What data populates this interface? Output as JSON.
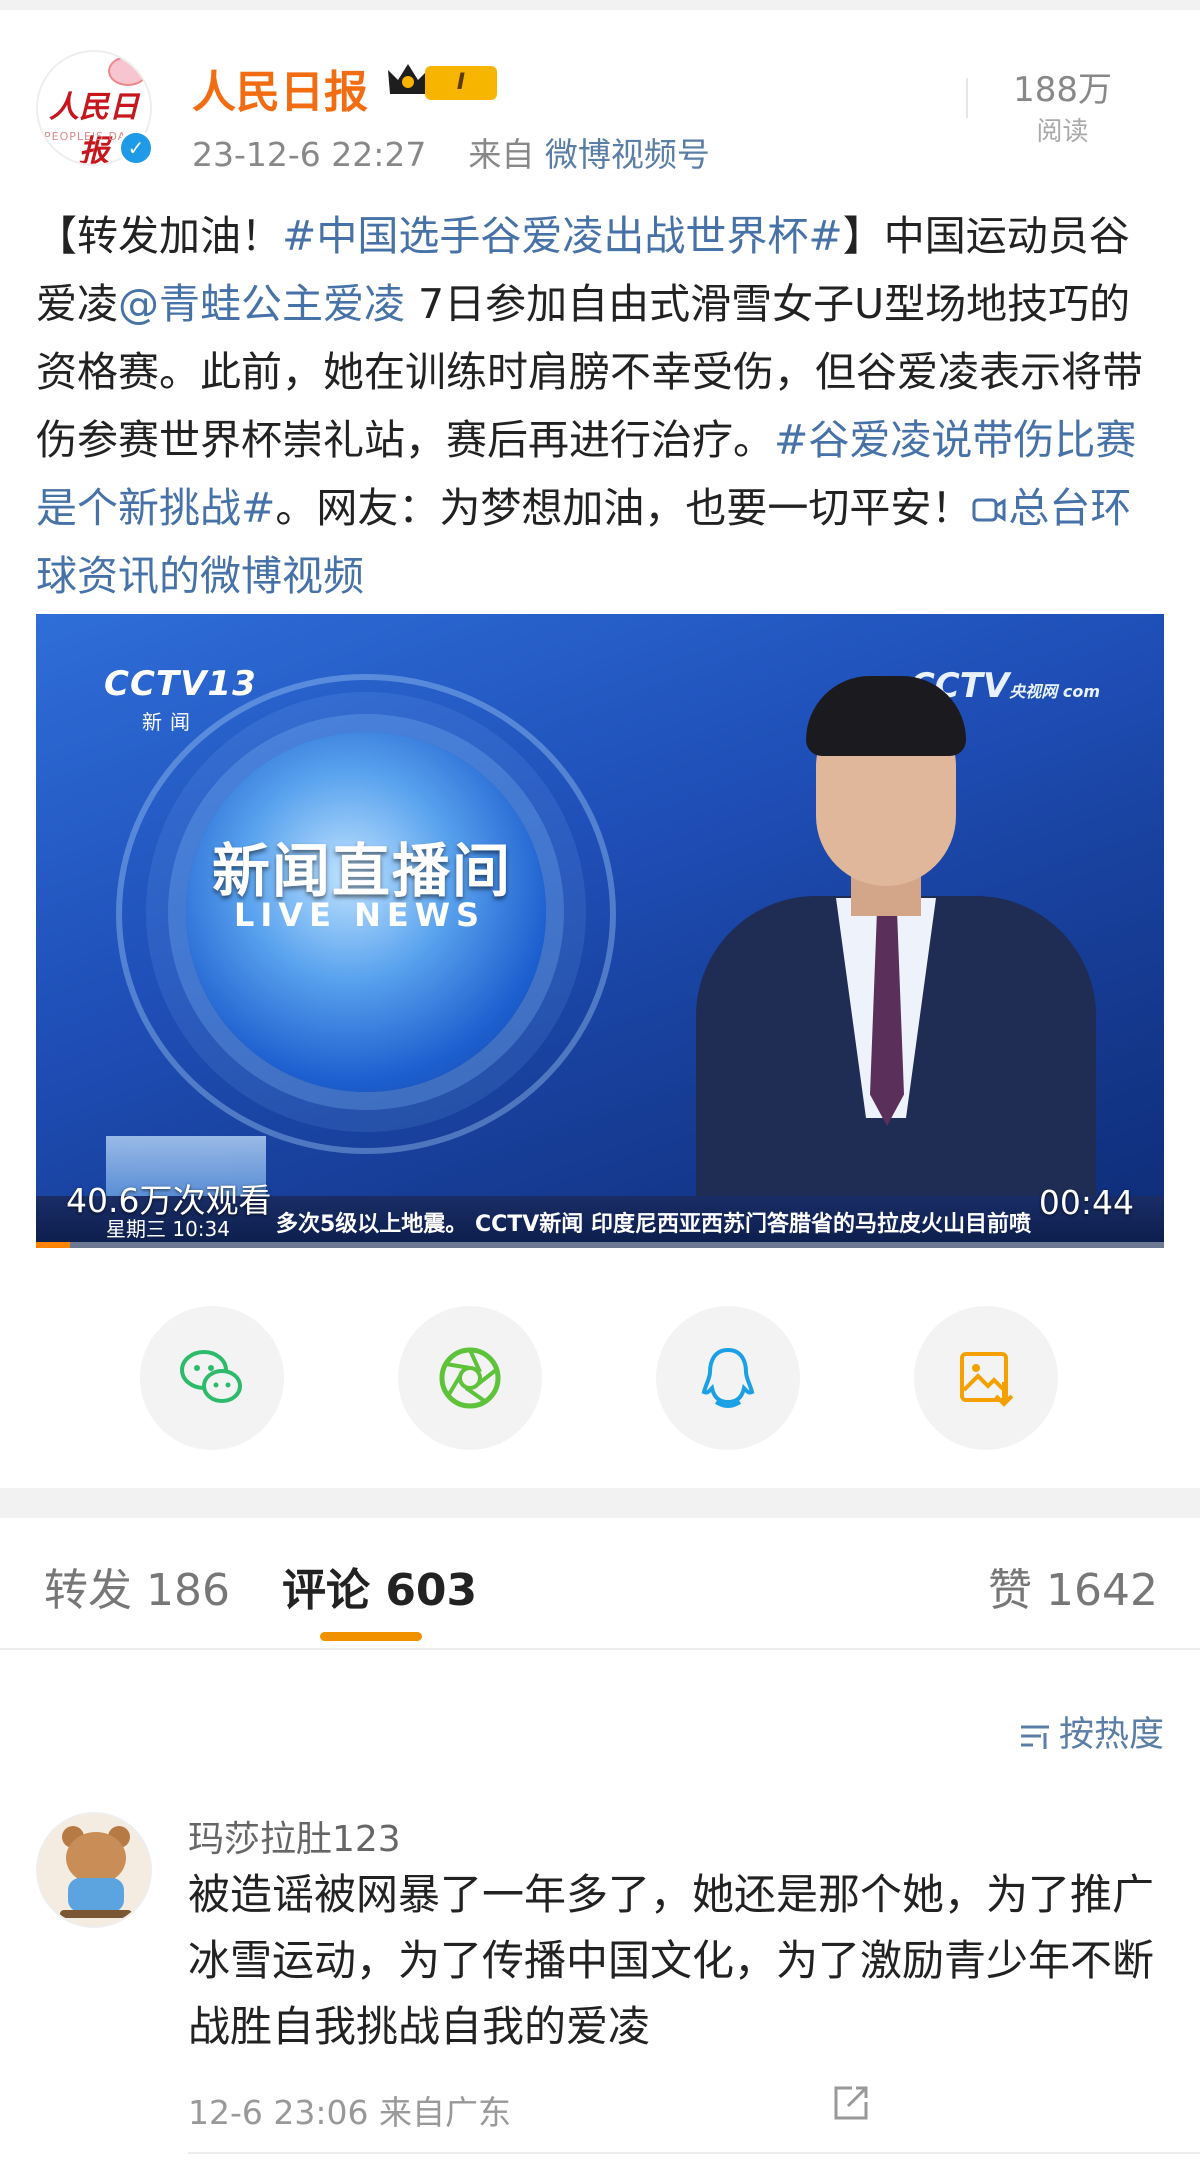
{
  "post": {
    "author": "人民日报",
    "level_badge": "I",
    "timestamp": "23-12-6 22:27",
    "source_prefix": "来自",
    "source": "微博视频号",
    "reads_count": "188万",
    "reads_label": "阅读",
    "text_parts": {
      "p1": "【转发加油！",
      "tag1": "#中国选手谷爱凌出战世界杯#",
      "p2": "】中国运动员谷爱凌",
      "mention": "@青蛙公主爱凌",
      "p3": " 7日参加自由式滑雪女子U型场地技巧的资格赛。此前，她在训练时肩膀不幸受伤，但谷爱凌表示将带伤参赛世界杯崇礼站，赛后再进行治疗。",
      "tag2": "#谷爱凌说带伤比赛是个新挑战#",
      "p4": "。网友：为梦想加油，也要一切平安！",
      "video_link": "总台环球资讯的微博视频"
    }
  },
  "video": {
    "channel_logo": "CCTV13",
    "channel_sub": "新闻",
    "corner_logo": "CCTV",
    "corner_logo_small": "央视网 com",
    "show_title": "新闻直播间",
    "show_subtitle": "LIVE NEWS",
    "ticker_date": "星期三 10:34",
    "ticker_text": "多次5级以上地震。 CCTV新闻 印度尼西亚西苏门答腊省的马拉皮火山目前喷",
    "views": "40.6万次观看",
    "duration": "00:44",
    "progress": 0.03
  },
  "share_icons": [
    "wechat-icon",
    "moments-icon",
    "qq-icon",
    "save-image-icon"
  ],
  "tabs": {
    "repost": "转发 186",
    "comment": "评论 603",
    "like": "赞 1642"
  },
  "sort_label": "按热度",
  "comments": [
    {
      "username": "玛莎拉肚123",
      "text": "被造谣被网暴了一年多了，她还是那个她，为了推广冰雪运动，为了传播中国文化，为了激励青少年不断战胜自我挑战自我的爱凌",
      "meta": "12-6 23:06 来自广东"
    }
  ],
  "colors": {
    "author_orange": "#f26c12",
    "link_blue": "#4672a8",
    "tab_underline": "#f29100",
    "verified_blue": "#1e9ae8",
    "wechat_green": "#2dbb6b",
    "moments_green": "#5ec23a",
    "qq_blue": "#1ba0e6",
    "save_orange": "#f4a100"
  }
}
